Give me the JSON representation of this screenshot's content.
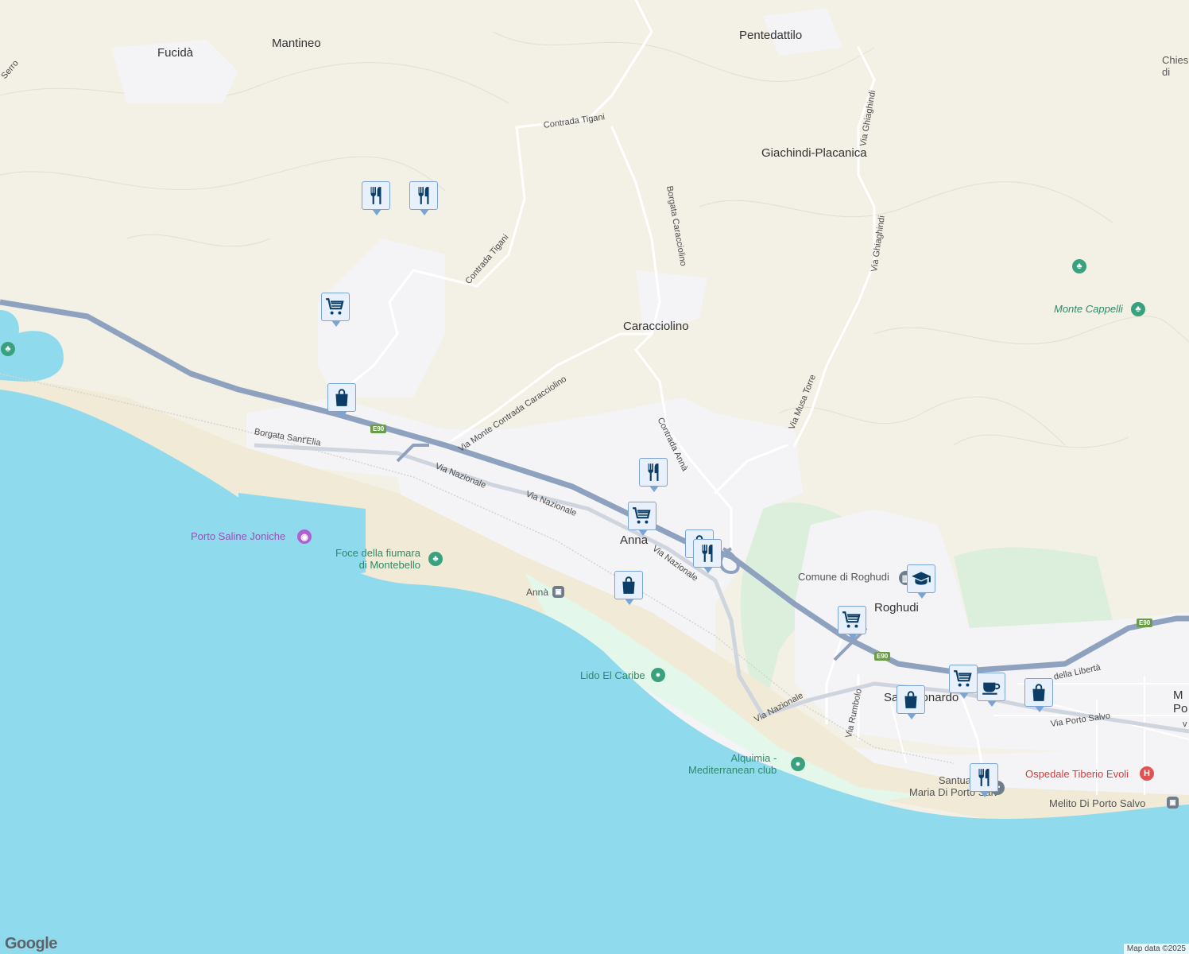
{
  "towns": {
    "fucida": "Fucidà",
    "mantineo": "Mantineo",
    "pentedattilo": "Pentedattilo",
    "giachindi": "Giachindi-Placanica",
    "caracciolino": "Caracciolino",
    "anna": "Anna",
    "roghudi": "Roghudi",
    "san_leonardo": "San Leonardo",
    "chiesa": "Chies\ndi",
    "melito": "M\nPo"
  },
  "roads": {
    "serro": "Serro",
    "contrada_tigani_1": "Contrada Tigani",
    "contrada_tigani_2": "Contrada Tigani",
    "borgata_caracciolino": "Borgata Caracciolino",
    "via_ghiaghindi_1": "Via Ghiaghindi",
    "via_ghiaghindi_2": "Via Ghiaghindi",
    "via_monte_contrada": "Via Monte Contrada Caracciolino",
    "contrada_anna": "Contrada Annà",
    "via_musa_torre": "Via Musa Torre",
    "borgata_santelia": "Borgata Sant'Elia",
    "via_nazionale_1": "Via Nazionale",
    "via_nazionale_2": "Via Nazionale",
    "via_nazionale_3": "Via Nazionale",
    "via_nazionale_4": "Via Nazionale",
    "via_rumbolo": "Via Rumbolo",
    "via_porto_salvo": "Via Porto Salvo",
    "della_liberta": "della Libertà",
    "v": "v"
  },
  "shields": [
    "E90",
    "E90",
    "E90"
  ],
  "pois": {
    "monte_cappelli": "Monte Cappelli",
    "porto_saline": "Porto Saline Joniche",
    "foce": "Foce della fiumara\ndi Montebello",
    "anna_station": "Annà",
    "lido": "Lido El Caribe",
    "alquimia": "Alquimia -\nMediterranean club",
    "comune_roghudi": "Comune di Roghudi",
    "santuario": "Santuario Sa\nMaria Di Porto Salv",
    "ospedale": "Ospedale Tiberio Evoli",
    "melito_station": "Melito Di Porto Salvo"
  },
  "markers": [
    {
      "type": "restaurant"
    },
    {
      "type": "restaurant"
    },
    {
      "type": "grocery"
    },
    {
      "type": "shopping"
    },
    {
      "type": "restaurant"
    },
    {
      "type": "grocery"
    },
    {
      "type": "shopping"
    },
    {
      "type": "restaurant"
    },
    {
      "type": "shopping"
    },
    {
      "type": "school"
    },
    {
      "type": "grocery"
    },
    {
      "type": "shopping"
    },
    {
      "type": "grocery"
    },
    {
      "type": "cafe"
    },
    {
      "type": "shopping"
    },
    {
      "type": "restaurant"
    }
  ],
  "colors": {
    "land": "#f3f0e6",
    "sea": "#8fdaed",
    "beach": "#f0ead6",
    "park": "#dcefdc",
    "urban": "#f4f4f6",
    "highway": "#8ea2bf",
    "marker_icon": "#0b3d66"
  },
  "logo": "Google",
  "attribution": "Map data ©2025"
}
